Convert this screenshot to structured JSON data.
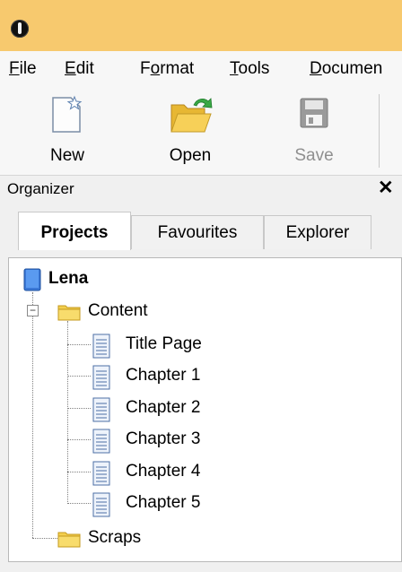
{
  "window": {
    "app_icon": "app-logo-icon"
  },
  "menu": {
    "items": [
      {
        "pre": "",
        "u": "F",
        "post": "ile"
      },
      {
        "pre": "",
        "u": "E",
        "post": "dit"
      },
      {
        "pre": "F",
        "u": "o",
        "post": "rmat"
      },
      {
        "pre": "",
        "u": "T",
        "post": "ools"
      },
      {
        "pre": "",
        "u": "D",
        "post": "ocumen"
      }
    ]
  },
  "toolbar": {
    "new_label": "New",
    "open_label": "Open",
    "save_label": "Save"
  },
  "organizer": {
    "title": "Organizer",
    "close_glyph": "✕",
    "tabs": [
      {
        "label": "Projects",
        "active": true
      },
      {
        "label": "Favourites",
        "active": false
      },
      {
        "label": "Explorer",
        "active": false
      }
    ],
    "tree": {
      "project": "Lena",
      "folder_content": "Content",
      "collapse_glyph": "−",
      "documents": [
        "Title Page",
        "Chapter 1",
        "Chapter 2",
        "Chapter 3",
        "Chapter 4",
        "Chapter 5"
      ],
      "folder_scraps": "Scraps"
    }
  },
  "colors": {
    "titlebar": "#f7c96e",
    "folder": "#f3cf4d",
    "book": "#3b79d8"
  }
}
